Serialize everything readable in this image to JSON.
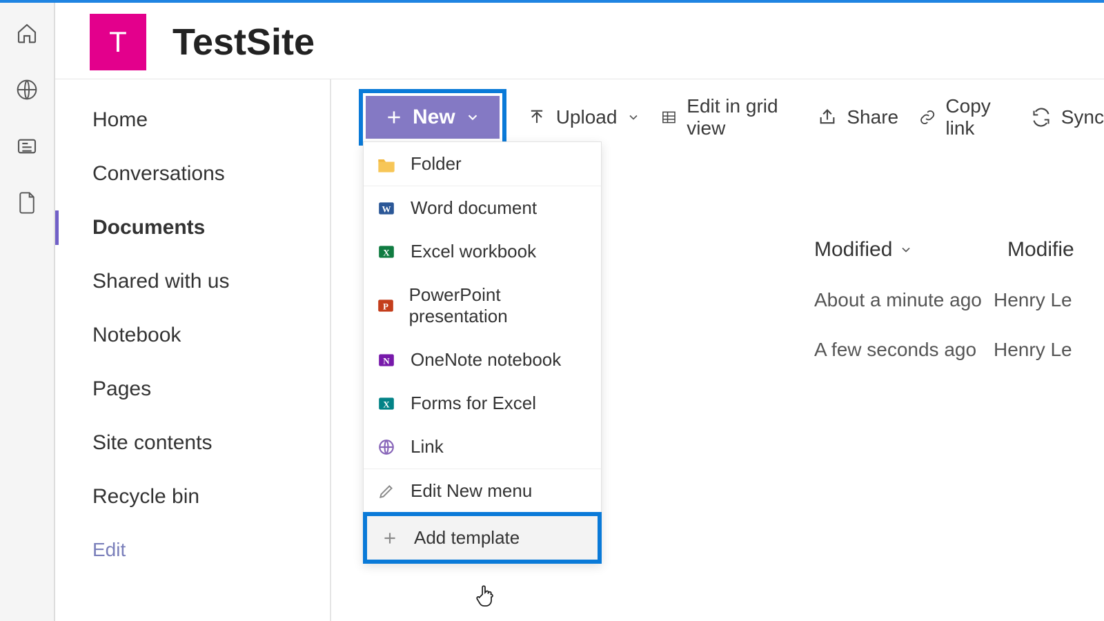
{
  "site": {
    "logo_letter": "T",
    "title": "TestSite"
  },
  "leftnav": {
    "items": [
      {
        "label": "Home",
        "active": false
      },
      {
        "label": "Conversations",
        "active": false
      },
      {
        "label": "Documents",
        "active": true
      },
      {
        "label": "Shared with us",
        "active": false
      },
      {
        "label": "Notebook",
        "active": false
      },
      {
        "label": "Pages",
        "active": false
      },
      {
        "label": "Site contents",
        "active": false
      },
      {
        "label": "Recycle bin",
        "active": false
      }
    ],
    "edit_label": "Edit"
  },
  "toolbar": {
    "new_label": "New",
    "upload_label": "Upload",
    "edit_grid_label": "Edit in grid view",
    "share_label": "Share",
    "copy_link_label": "Copy link",
    "sync_label": "Sync"
  },
  "new_menu": {
    "items": [
      {
        "label": "Folder",
        "icon": "folder"
      },
      {
        "label": "Word document",
        "icon": "word"
      },
      {
        "label": "Excel workbook",
        "icon": "excel"
      },
      {
        "label": "PowerPoint presentation",
        "icon": "ppt"
      },
      {
        "label": "OneNote notebook",
        "icon": "onenote"
      },
      {
        "label": "Forms for Excel",
        "icon": "forms"
      },
      {
        "label": "Link",
        "icon": "link"
      }
    ],
    "footer": [
      {
        "label": "Edit New menu",
        "icon": "pencil"
      },
      {
        "label": "Add template",
        "icon": "plus",
        "highlighted": true
      }
    ]
  },
  "columns": {
    "modified": "Modified",
    "modified_by": "Modifie"
  },
  "rows": [
    {
      "modified": "About a minute ago",
      "by": "Henry Le"
    },
    {
      "modified": "A few seconds ago",
      "by": "Henry Le"
    }
  ]
}
